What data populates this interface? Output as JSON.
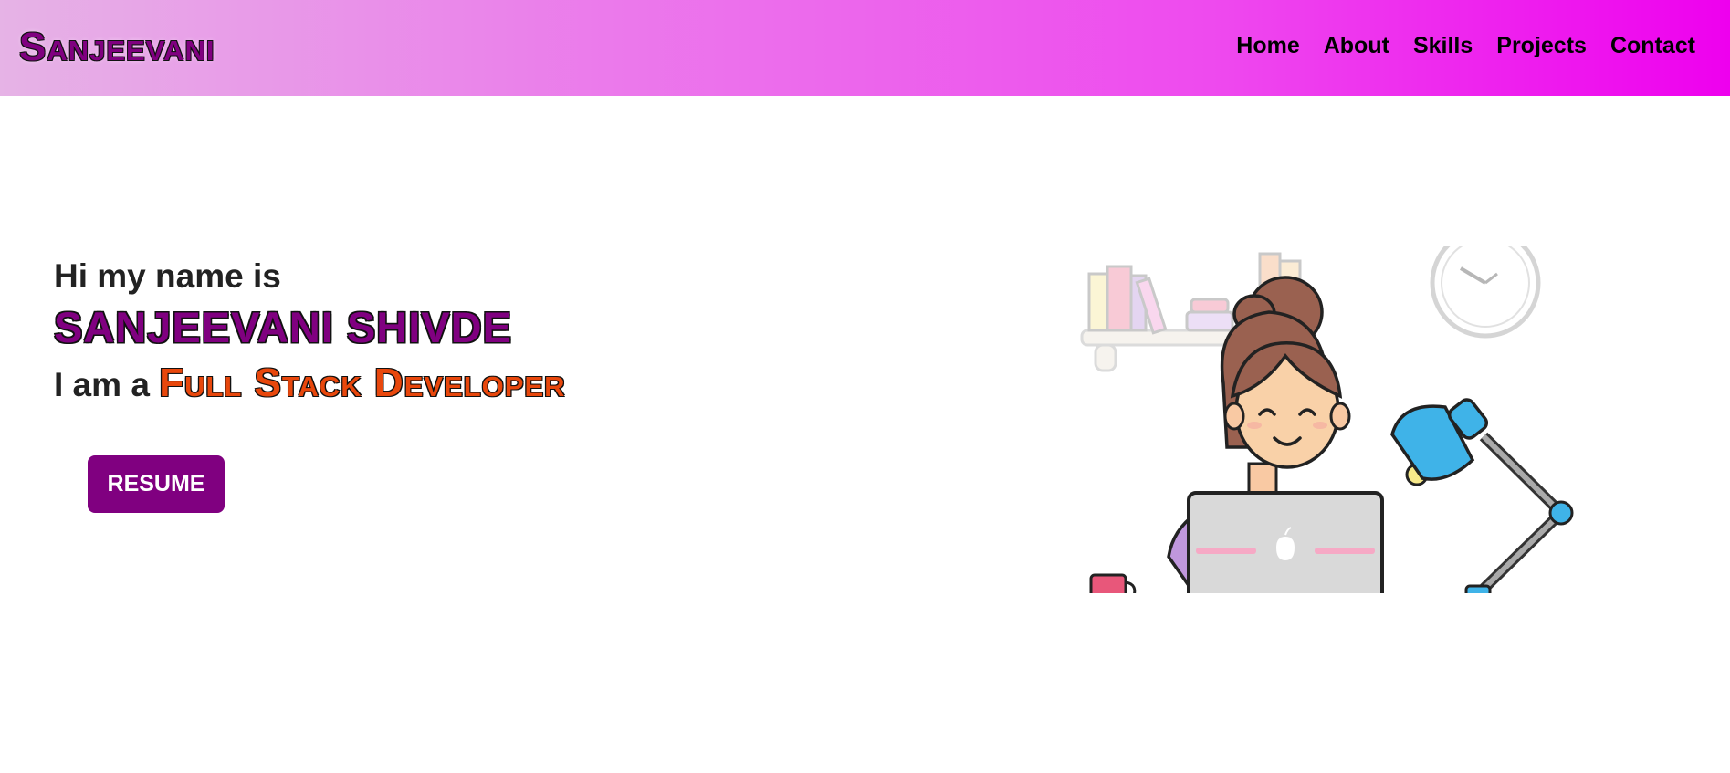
{
  "header": {
    "brand": "Sanjeevani",
    "nav": [
      {
        "label": "Home"
      },
      {
        "label": "About"
      },
      {
        "label": "Skills"
      },
      {
        "label": "Projects"
      },
      {
        "label": "Contact"
      }
    ]
  },
  "hero": {
    "greeting": "Hi my name is",
    "name": "SANJEEVANI SHIVDE",
    "role_prefix": "I am a ",
    "role": "Full Stack Developer",
    "resume_button": "RESUME"
  },
  "colors": {
    "brand": "#800080",
    "accent_orange": "#e8470c",
    "nav_gradient_start": "#e6b3e6",
    "nav_gradient_end": "#ee00ee"
  },
  "icons": {
    "illustration": "developer-at-laptop-illustration"
  }
}
